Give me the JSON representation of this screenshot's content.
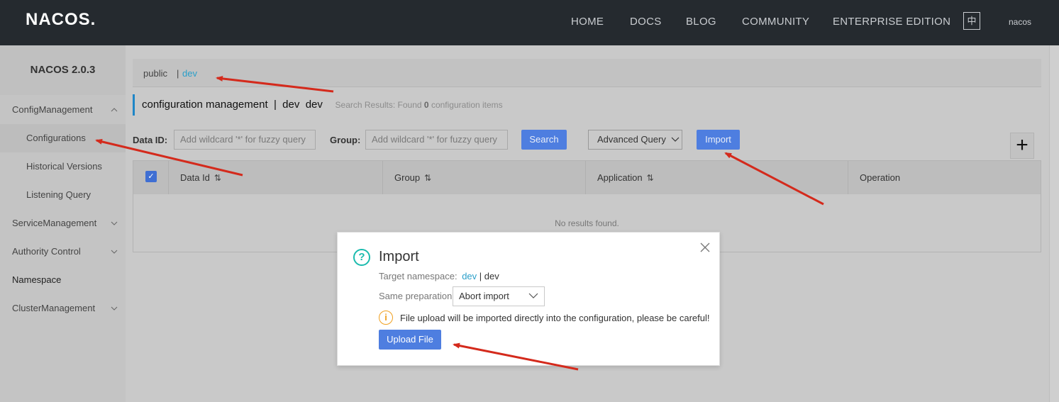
{
  "header": {
    "logo": "NACOS.",
    "nav": [
      "HOME",
      "DOCS",
      "BLOG",
      "COMMUNITY",
      "ENTERPRISE EDITION"
    ],
    "lang": "中",
    "user": "nacos"
  },
  "sidebar": {
    "title": "NACOS 2.0.3",
    "items": [
      {
        "label": "ConfigManagement",
        "icon": "chevron-up-icon"
      },
      {
        "label": "Configurations"
      },
      {
        "label": "Historical Versions"
      },
      {
        "label": "Listening Query"
      },
      {
        "label": "ServiceManagement",
        "icon": "chevron-down-icon"
      },
      {
        "label": "Authority Control",
        "icon": "chevron-down-icon"
      },
      {
        "label": "Namespace"
      },
      {
        "label": "ClusterManagement",
        "icon": "chevron-down-icon"
      }
    ]
  },
  "namespaces": {
    "public": "public",
    "sep": "|",
    "dev": "dev"
  },
  "page": {
    "title": "configuration management  |  dev  dev",
    "results_prefix": "Search Results: Found",
    "results_count": "0",
    "results_suffix": "configuration items"
  },
  "filters": {
    "data_id_label": "Data ID:",
    "data_id_placeholder": "Add wildcard '*' for fuzzy query",
    "group_label": "Group:",
    "group_placeholder": "Add wildcard '*' for fuzzy query",
    "search": "Search",
    "advanced": "Advanced Query",
    "import": "Import",
    "add": "+"
  },
  "table": {
    "columns": [
      "Data Id",
      "Group",
      "Application",
      "Operation"
    ],
    "empty": "No results found."
  },
  "dialog": {
    "title": "Import",
    "target_label": "Target namespace:",
    "target_ns": "dev",
    "target_sep": " | ",
    "target_name": "dev",
    "same_label": "Same preparation:",
    "same_value": "Abort import",
    "warning": "File upload will be imported directly into the configuration, please be careful!",
    "upload": "Upload File"
  },
  "colors": {
    "accent": "#4e7ee0",
    "link": "#2a9fc9",
    "arrow": "#d42a1c"
  }
}
